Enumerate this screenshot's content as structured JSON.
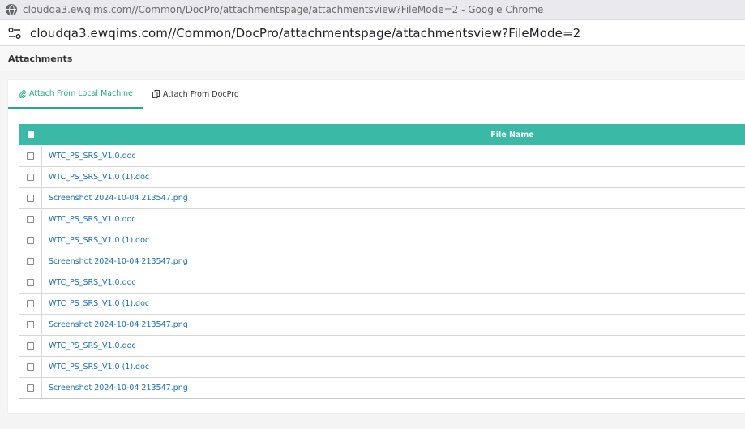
{
  "browser": {
    "window_title": "cloudqa3.ewqims.com//Common/DocPro/attachmentspage/attachmentsview?FileMode=2 - Google Chrome",
    "url": "cloudqa3.ewqims.com//Common/DocPro/attachmentspage/attachmentsview?FileMode=2"
  },
  "page": {
    "title": "Attachments"
  },
  "tabs": [
    {
      "label": "Attach From Local Machine",
      "active": true,
      "icon": "paperclip-icon"
    },
    {
      "label": "Attach From DocPro",
      "active": false,
      "icon": "copy-icon"
    }
  ],
  "grid": {
    "column_title": "File Name",
    "rows": [
      "WTC_PS_SRS_V1.0.doc",
      "WTC_PS_SRS_V1.0 (1).doc",
      "Screenshot 2024-10-04 213547.png",
      "WTC_PS_SRS_V1.0.doc",
      "WTC_PS_SRS_V1.0 (1).doc",
      "Screenshot 2024-10-04 213547.png",
      "WTC_PS_SRS_V1.0.doc",
      "WTC_PS_SRS_V1.0 (1).doc",
      "Screenshot 2024-10-04 213547.png",
      "WTC_PS_SRS_V1.0.doc",
      "WTC_PS_SRS_V1.0 (1).doc",
      "Screenshot 2024-10-04 213547.png"
    ]
  },
  "colors": {
    "accent": "#2aa58a",
    "grid_header": "#3ab9a6",
    "link": "#1f6fa8"
  }
}
